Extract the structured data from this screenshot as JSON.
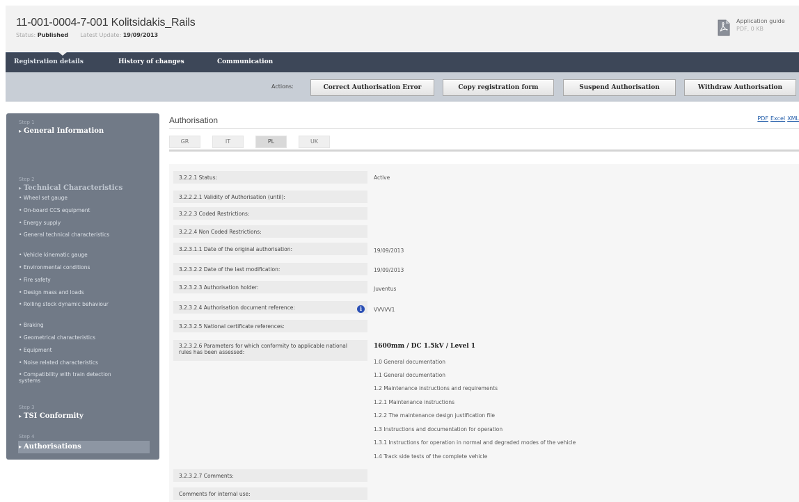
{
  "header": {
    "title": "11-001-0004-7-001 Kolitsidakis_Rails",
    "status_label": "Status:",
    "status_value": "Published",
    "update_label": "Latest Update:",
    "update_value": "19/09/2013",
    "guide_title": "Application guide",
    "guide_sub": "PDF, 0 KB",
    "guide_icon": "pdf-file-icon"
  },
  "tabs": [
    "Registration details",
    "History of changes",
    "Communication"
  ],
  "actions": {
    "label": "Actions:",
    "buttons": [
      "Correct Authorisation Error",
      "Copy registration form",
      "Suspend Authorisation",
      "Withdraw Authorisation"
    ]
  },
  "sidebar": {
    "steps": [
      {
        "label": "Step 1",
        "title": "General Information"
      },
      {
        "label": "Step 2",
        "title": "Technical Characteristics"
      },
      {
        "label": "Step 3",
        "title": "TSI Conformity"
      },
      {
        "label": "Step 4",
        "title": "Authorisations"
      }
    ],
    "sub_items": [
      "Wheel set gauge",
      "On-board CCS equipment",
      "Energy supply",
      "General technical characteristics",
      "Vehicle kinematic gauge",
      "Environmental conditions",
      "Fire safety",
      "Design mass and loads",
      "Rolling stock dynamic behaviour",
      "Braking",
      "Geometrical characteristics",
      "Equipment",
      "Noise related characteristics",
      "Compatibility with train detection systems"
    ]
  },
  "content": {
    "title": "Authorisation",
    "export": [
      "PDF",
      "Excel",
      "XML"
    ],
    "country_tabs": [
      "GR",
      "IT",
      "PL",
      "UK"
    ],
    "active_tab": "PL",
    "rows": [
      {
        "label": "3.2.2.1 Status:",
        "value": "Active"
      },
      {
        "label": "3.2.2.2.1 Validity of Authorisation (until):",
        "value": ""
      },
      {
        "label": "3.2.2.3 Coded Restrictions:",
        "value": ""
      },
      {
        "label": "3.2.2.4 Non Coded Restrictions:",
        "value": ""
      },
      {
        "label": "3.2.3.1.1 Date of the original authorisation:",
        "value": "19/09/2013"
      },
      {
        "label": "3.2.3.2.2 Date of the last modification:",
        "value": "19/09/2013"
      },
      {
        "label": "3.2.3.2.3 Authorisation holder:",
        "value": "Juventus"
      },
      {
        "label": "3.2.3.2.4 Authorisation document reference:",
        "value": "VVVVV1"
      },
      {
        "label": "3.2.3.2.5 National certificate references:",
        "value": ""
      },
      {
        "label": "3.2.3.2.6 Parameters for which conformity to applicable national rules has been assessed:",
        "value": "1600mm / DC 1.5kV / Level 1"
      },
      {
        "label": "3.2.3.2.7 Comments:",
        "value": ""
      },
      {
        "label": "Comments for internal use:",
        "value": ""
      }
    ],
    "parameters": [
      "1.0 General documentation",
      "1.1 General documentation",
      "1.2 Maintenance instructions and requirements",
      "1.2.1 Maintenance instructions",
      "1.2.2 The maintenance design justification file",
      "1.3 Instructions and documentation for operation",
      "1.3.1 Instructions for operation in normal and degraded modes of the vehicle",
      "1.4 Track side tests of the complete vehicle"
    ]
  },
  "colors": {
    "tabbar": "#3d4758",
    "actions_bar": "#c8ced6",
    "sidebar": "#717a87",
    "link": "#1e5aa8",
    "info_icon": "#2a4fb5"
  }
}
